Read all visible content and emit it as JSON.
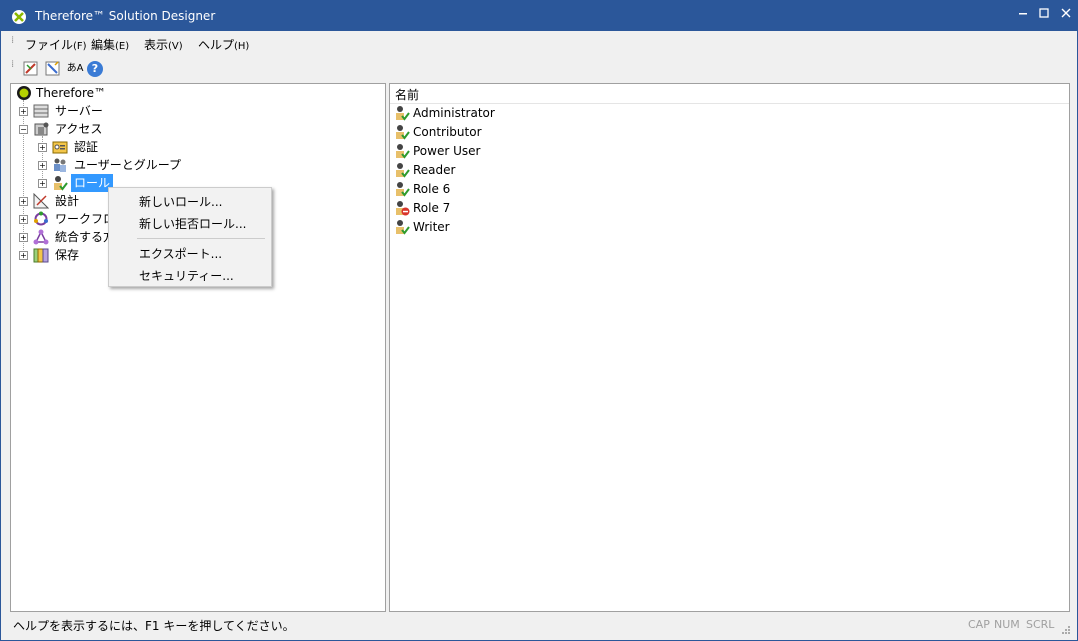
{
  "window": {
    "title": "Therefore™ Solution Designer"
  },
  "menubar": {
    "items": [
      {
        "label": "ファイル",
        "accel": "(F)"
      },
      {
        "label": "編集",
        "accel": "(E)"
      },
      {
        "label": "表示",
        "accel": "(V)"
      },
      {
        "label": "ヘルプ",
        "accel": "(H)"
      }
    ]
  },
  "toolbar": {
    "buttons": [
      "designer-tool-icon",
      "designer-wizard-icon",
      "language-icon",
      "help-icon"
    ],
    "help_glyph": "?",
    "lang_glyph": "あA"
  },
  "tree": {
    "root": "Therefore™",
    "nodes": [
      {
        "label": "サーバー",
        "icon": "server-icon"
      },
      {
        "label": "アクセス",
        "icon": "access-icon"
      },
      {
        "label": "認証",
        "icon": "authentication-icon"
      },
      {
        "label": "ユーザーとグループ",
        "icon": "users-groups-icon"
      },
      {
        "label": "ロール",
        "icon": "role-icon"
      },
      {
        "label": "設計",
        "icon": "design-icon"
      },
      {
        "label": "ワークフロー",
        "icon": "workflow-icon"
      },
      {
        "label": "統合する方",
        "icon": "integration-icon"
      },
      {
        "label": "保存",
        "icon": "storage-icon"
      }
    ]
  },
  "context_menu": {
    "items": [
      "新しいロール...",
      "新しい拒否ロール...",
      "エクスポート...",
      "セキュリティー..."
    ]
  },
  "list": {
    "header": "名前",
    "rows": [
      {
        "name": "Administrator",
        "type": "allow"
      },
      {
        "name": "Contributor",
        "type": "allow"
      },
      {
        "name": "Power User",
        "type": "allow"
      },
      {
        "name": "Reader",
        "type": "allow"
      },
      {
        "name": "Role 6",
        "type": "allow"
      },
      {
        "name": "Role 7",
        "type": "deny"
      },
      {
        "name": "Writer",
        "type": "allow"
      }
    ]
  },
  "statusbar": {
    "text": "ヘルプを表示するには、F1 キーを押してください。",
    "indicators": [
      "CAP",
      "NUM",
      "SCRL"
    ]
  },
  "colors": {
    "titlebar": "#2b579a",
    "selection": "#3399ff",
    "allow_check": "#2e9b2e",
    "deny_mark": "#d9342b"
  }
}
